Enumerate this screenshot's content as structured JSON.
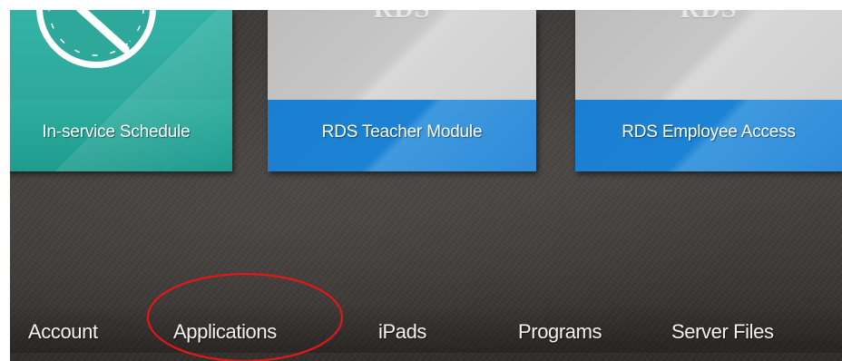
{
  "tiles": [
    {
      "label": "In-service Schedule",
      "icon": "clock-icon"
    },
    {
      "label": "RDS Teacher Module",
      "logo": "RDS"
    },
    {
      "label": "RDS Employee Access",
      "logo": "RDS"
    }
  ],
  "nav": {
    "items": [
      "Account",
      "Applications",
      "iPads",
      "Programs",
      "Server Files"
    ],
    "highlighted": "Applications"
  },
  "colors": {
    "inservice_teal": "#2ea89b",
    "rds_blue": "#1c82d4",
    "rds_gray": "#c7c7c7",
    "background": "#3e3a37",
    "annotation_red": "#e01818"
  }
}
